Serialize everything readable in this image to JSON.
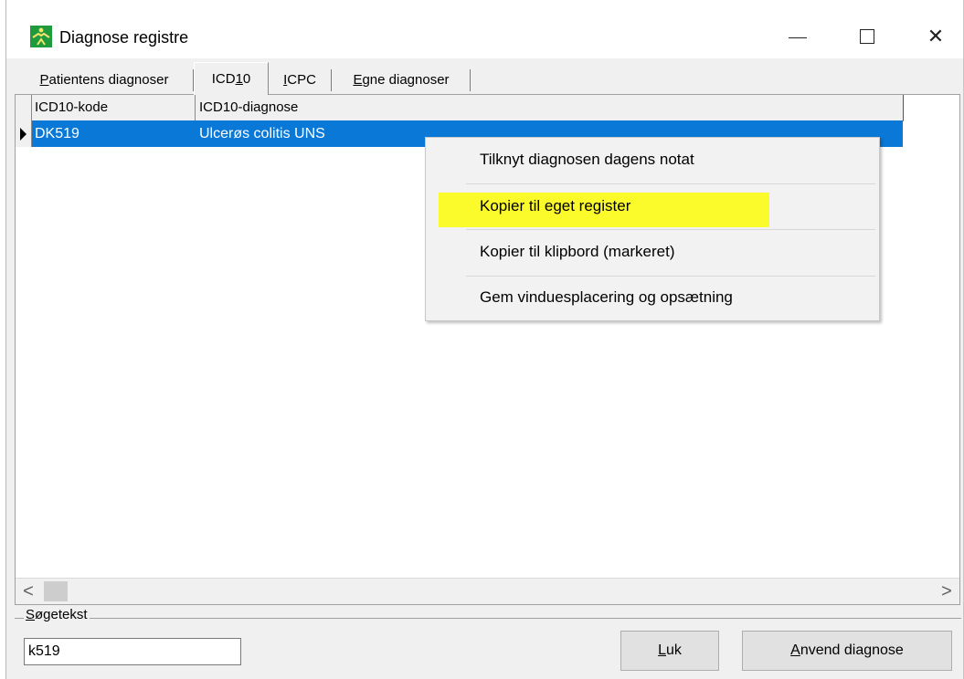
{
  "window": {
    "title": "Diagnose registre",
    "minimize_label": "",
    "maximize_label": "",
    "close_label": "✕"
  },
  "tabs": [
    {
      "accel": "P",
      "rest": "atientens diagnoser",
      "active": false
    },
    {
      "pre": "ICD",
      "accel": "1",
      "rest": "0",
      "active": true
    },
    {
      "accel": "I",
      "rest": "CPC",
      "active": false
    },
    {
      "accel": "E",
      "rest": "gne diagnoser",
      "active": false
    }
  ],
  "grid": {
    "columns": [
      "ICD10-kode",
      "ICD10-diagnose"
    ],
    "rows": [
      {
        "code": "DK519",
        "diagnosis": "Ulcerøs colitis UNS",
        "selected": true
      }
    ]
  },
  "context_menu": {
    "items": [
      {
        "label": "Tilknyt diagnosen dagens notat",
        "highlighted": false
      },
      {
        "label": "Kopier til eget register",
        "highlighted": true
      },
      {
        "label": "Kopier til klipbord (markeret)",
        "highlighted": false
      },
      {
        "label": "Gem vinduesplacering og opsætning",
        "highlighted": false
      }
    ]
  },
  "scrollbar": {
    "left_arrow": "<",
    "right_arrow": ">"
  },
  "search": {
    "label_accel": "S",
    "label_rest": "øgetekst",
    "value": "k519"
  },
  "buttons": {
    "close": {
      "accel": "L",
      "rest": "uk"
    },
    "apply": {
      "accel": "A",
      "rest": "nvend diagnose"
    }
  },
  "colors": {
    "selection": "#0a78d7",
    "highlight": "#fbfb2b",
    "app_icon": "#1f9a3c"
  }
}
